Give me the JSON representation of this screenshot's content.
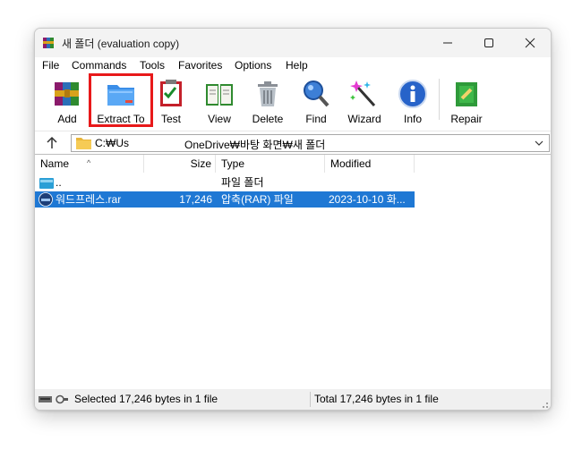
{
  "window": {
    "title": "새 폴더 (evaluation copy)"
  },
  "menu": [
    "File",
    "Commands",
    "Tools",
    "Favorites",
    "Options",
    "Help"
  ],
  "toolbar": {
    "add": "Add",
    "extract_to": "Extract To",
    "test": "Test",
    "view": "View",
    "delete": "Delete",
    "find": "Find",
    "wizard": "Wizard",
    "info": "Info",
    "repair": "Repair"
  },
  "address": {
    "part1": "C:₩Us",
    "part2": "OneDrive₩바탕 화면₩새 폴더"
  },
  "columns": {
    "name": "Name",
    "size": "Size",
    "type": "Type",
    "modified": "Modified"
  },
  "rows": [
    {
      "name": "..",
      "size": "",
      "type": "파일 폴더",
      "modified": "",
      "icon": "folder-up-icon",
      "selected": false
    },
    {
      "name": "워드프레스.rar",
      "size": "17,246",
      "type": "압축(RAR) 파일",
      "modified": "2023-10-10 화...",
      "icon": "rar-archive-icon",
      "selected": true
    }
  ],
  "status": {
    "left": "Selected 17,246 bytes in 1 file",
    "right": "Total 17,246 bytes in 1 file"
  },
  "colors": {
    "selection": "#1f78d4",
    "highlight": "#e8191a"
  }
}
